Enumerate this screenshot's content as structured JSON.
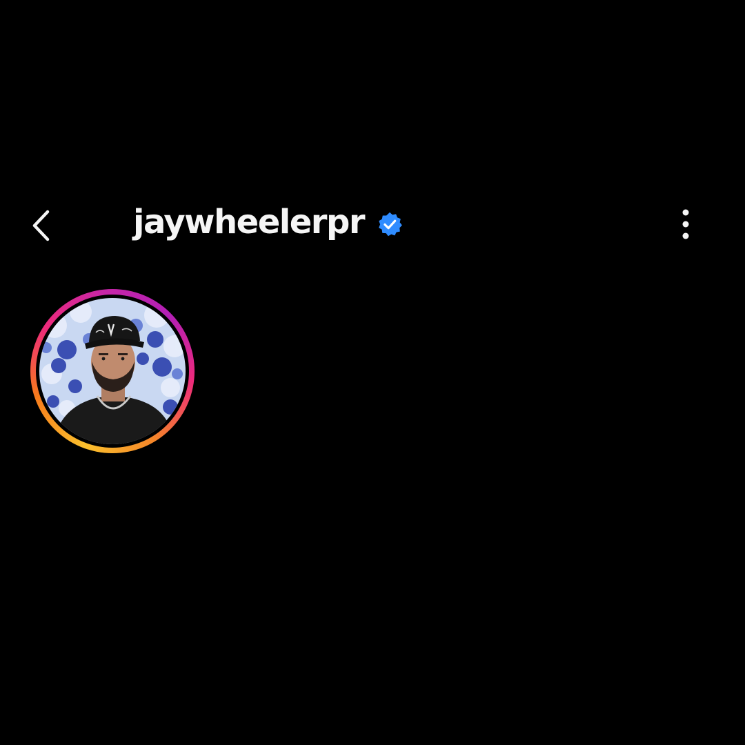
{
  "header": {
    "username": "jaywheelerpr",
    "back_icon": "chevron-left-icon",
    "verified_icon": "verified-badge-icon",
    "more_icon": "more-vertical-icon"
  },
  "profile": {
    "avatar_icon": "profile-photo",
    "story_ring": true
  },
  "colors": {
    "background": "#000000",
    "text": "#f5f5f5",
    "verified": "#2f8cff",
    "ring_start": "#fbc02d",
    "ring_mid": "#ee2a7b",
    "ring_end": "#b31fb6"
  }
}
